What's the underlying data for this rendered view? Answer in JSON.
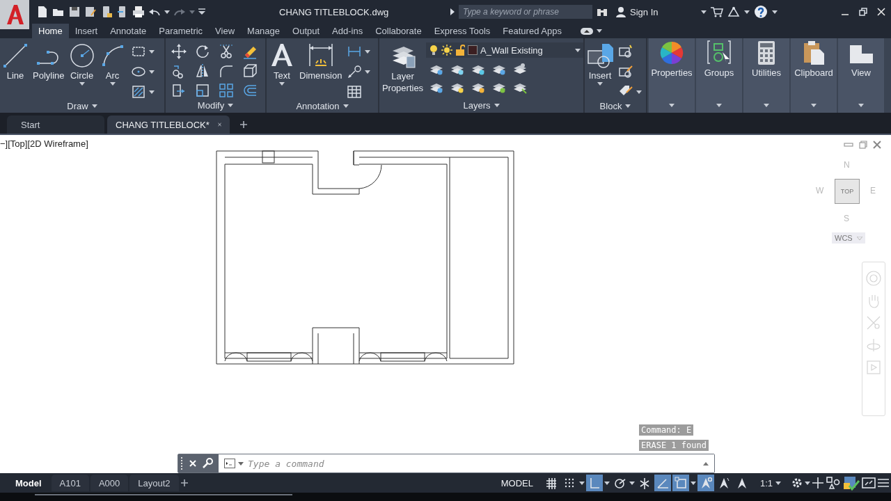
{
  "title_bar": {
    "title": "CHANG TITLEBLOCK.dwg",
    "search": {
      "placeholder": "Type a keyword or phrase"
    },
    "account": "Sign In"
  },
  "ribbon_tabs": [
    {
      "label": "Home",
      "selected": true
    },
    {
      "label": "Insert",
      "selected": false
    },
    {
      "label": "Annotate",
      "selected": false
    },
    {
      "label": "Parametric",
      "selected": false
    },
    {
      "label": "View",
      "selected": false
    },
    {
      "label": "Manage",
      "selected": false
    },
    {
      "label": "Output",
      "selected": false
    },
    {
      "label": "Add-ins",
      "selected": false
    },
    {
      "label": "Collaborate",
      "selected": false
    },
    {
      "label": "Express Tools",
      "selected": false
    },
    {
      "label": "Featured Apps",
      "selected": false
    }
  ],
  "ribbon_panels": [
    {
      "kind": "draw",
      "title": "Draw",
      "tools": [
        {
          "label": "Line",
          "dropdown": false
        },
        {
          "label": "Polyline",
          "dropdown": false
        },
        {
          "label": "Circle",
          "dropdown": true
        },
        {
          "label": "Arc",
          "dropdown": true
        }
      ]
    },
    {
      "kind": "modify",
      "title": "Modify"
    },
    {
      "kind": "annotation",
      "title": "Annotation",
      "tools": [
        {
          "label": "Text",
          "dropdown": true
        },
        {
          "label": "Dimension",
          "dropdown": false
        }
      ]
    },
    {
      "kind": "layers",
      "title": "Layers",
      "layer": "A_Wall Existing",
      "tools": [
        {
          "label": "Layer Properties",
          "dropdown": false
        }
      ]
    },
    {
      "kind": "block",
      "title": "Block",
      "tools": [
        {
          "label": "Insert",
          "dropdown": true
        }
      ]
    },
    {
      "kind": "big",
      "tools": [
        {
          "label": "Properties",
          "dropdown": true
        }
      ]
    },
    {
      "kind": "big",
      "tools": [
        {
          "label": "Groups",
          "dropdown": true
        }
      ]
    },
    {
      "kind": "big",
      "tools": [
        {
          "label": "Utilities",
          "dropdown": true
        }
      ]
    },
    {
      "kind": "big",
      "tools": [
        {
          "label": "Clipboard",
          "dropdown": true
        }
      ]
    },
    {
      "kind": "big",
      "tools": [
        {
          "label": "View",
          "dropdown": true
        }
      ]
    }
  ],
  "file_tabs": [
    {
      "label": "Start",
      "selected": false
    },
    {
      "label": "CHANG TITLEBLOCK*",
      "selected": true
    }
  ],
  "viewport": {
    "label": "−][Top][2D Wireframe]"
  },
  "viewcube": {
    "north": "N",
    "west": "W",
    "face": "TOP",
    "east": "E",
    "south": "S",
    "ucs": "WCS"
  },
  "command_line": {
    "history": [
      "Command: E",
      "ERASE 1 found"
    ],
    "placeholder": "Type a command"
  },
  "layout_tabs": [
    {
      "label": "Model",
      "selected": true
    },
    {
      "label": "A101",
      "selected": false
    },
    {
      "label": "A000",
      "selected": false
    },
    {
      "label": "Layout2",
      "selected": false
    }
  ],
  "status_bar": {
    "space": "MODEL",
    "scale": "1:1",
    "toggles": [
      {
        "on": false,
        "dropdown": false
      },
      {
        "on": false,
        "dropdown": true
      },
      {
        "on": true,
        "dropdown": true
      },
      {
        "on": false,
        "dropdown": true
      },
      {
        "on": false,
        "dropdown": false
      },
      {
        "on": true,
        "dropdown": false
      },
      {
        "on": true,
        "dropdown": true
      },
      {
        "on": true,
        "dropdown": false
      },
      {
        "on": false,
        "dropdown": false
      },
      {
        "on": false,
        "dropdown": false
      }
    ]
  }
}
